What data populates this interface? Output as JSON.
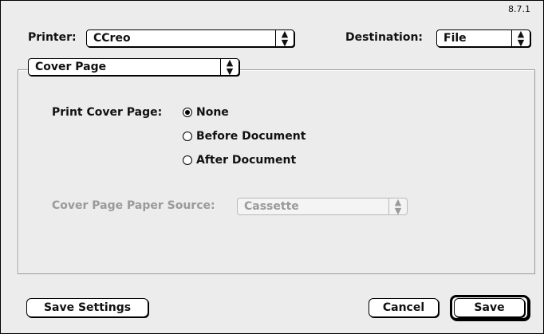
{
  "version": "8.7.1",
  "printer": {
    "label": "Printer:",
    "value": "CCreo"
  },
  "destination": {
    "label": "Destination:",
    "value": "File"
  },
  "panel_select": {
    "value": "Cover Page"
  },
  "cover": {
    "label": "Print Cover Page:",
    "options": [
      {
        "label": "None",
        "selected": true
      },
      {
        "label": "Before Document",
        "selected": false
      },
      {
        "label": "After Document",
        "selected": false
      }
    ]
  },
  "paper_source": {
    "label": "Cover Page Paper Source:",
    "value": "Cassette",
    "enabled": false
  },
  "buttons": {
    "save_settings": "Save Settings",
    "cancel": "Cancel",
    "save": "Save"
  },
  "icons": {
    "popup_arrows": "up-down-arrows-icon",
    "radio": "radio-icon"
  }
}
